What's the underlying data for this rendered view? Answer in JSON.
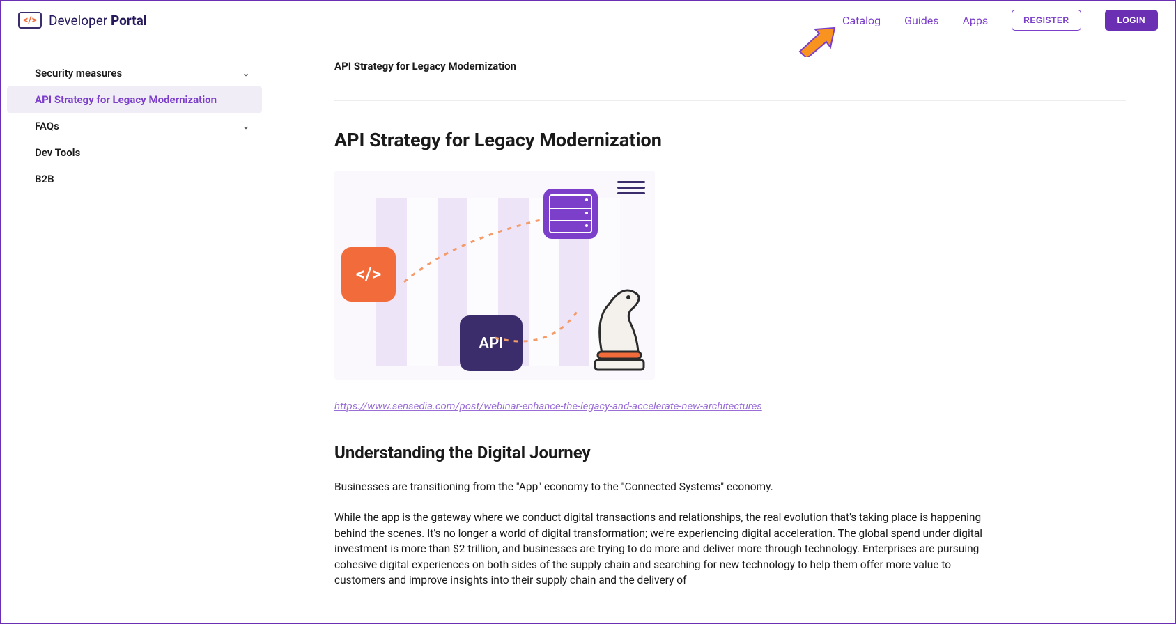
{
  "header": {
    "logo_text_light": "Developer ",
    "logo_text_bold": "Portal",
    "nav": {
      "catalog": "Catalog",
      "guides": "Guides",
      "apps": "Apps"
    },
    "register": "REGISTER",
    "login": "LOGIN"
  },
  "sidebar": {
    "items": [
      {
        "label": "Security measures",
        "expandable": true
      },
      {
        "label": "API Strategy for Legacy Modernization",
        "active": true
      },
      {
        "label": "FAQs",
        "expandable": true
      },
      {
        "label": "Dev Tools"
      },
      {
        "label": "B2B"
      }
    ]
  },
  "main": {
    "breadcrumb": "API Strategy for Legacy Modernization",
    "title": "API Strategy for Legacy Modernization",
    "hero": {
      "api_label": "API"
    },
    "source_link": "https://www.sensedia.com/post/webinar-enhance-the-legacy-and-accelerate-new-architectures",
    "section_title": "Understanding the Digital Journey",
    "para1": "Businesses are transitioning from the \"App\" economy to the \"Connected Systems\" economy.",
    "para2": "While the app is the gateway where we conduct digital transactions and relationships, the real evolution that's taking place is happening behind the scenes. It's no longer a world of digital transformation; we're experiencing digital acceleration. The global spend under digital investment is more than $2 trillion, and businesses are trying to do more and deliver more through technology. Enterprises are pursuing cohesive digital experiences on both sides of the supply chain and searching for new technology to help them offer more value to customers and improve insights into their supply chain and the delivery of"
  }
}
